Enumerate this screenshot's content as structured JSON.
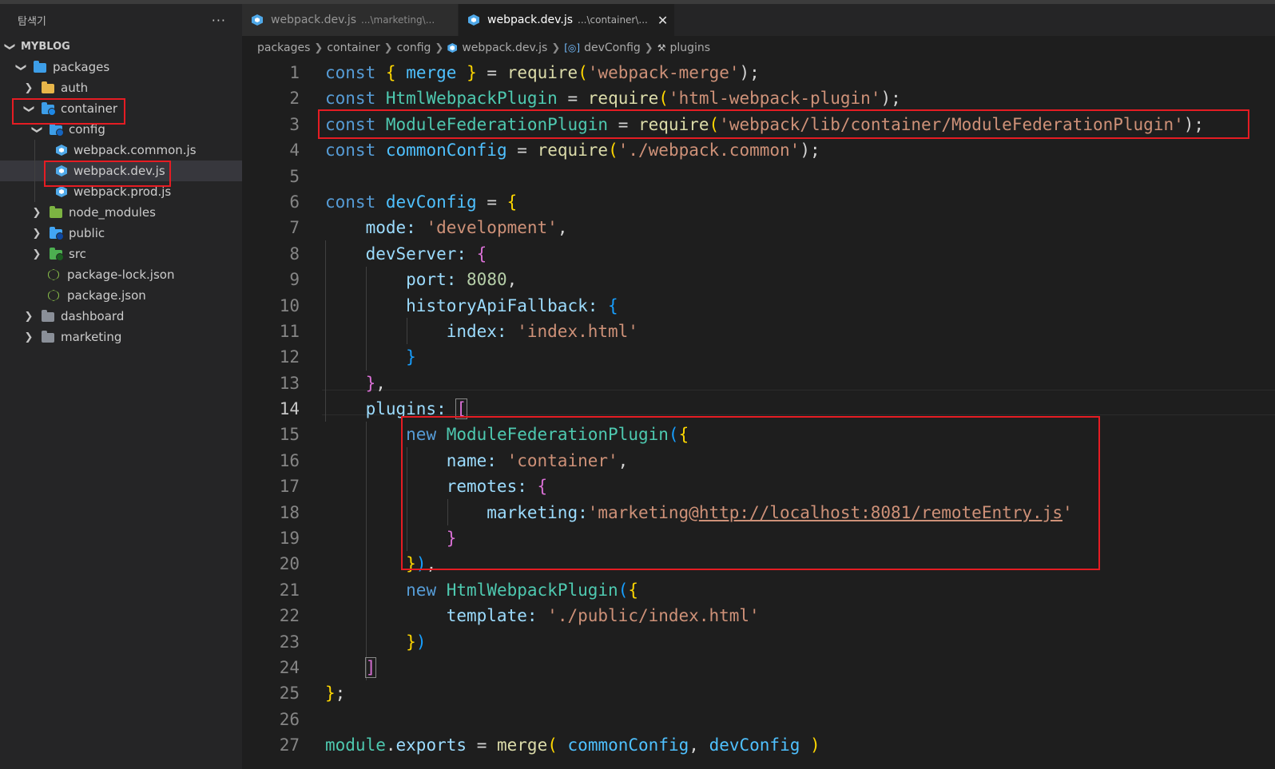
{
  "explorer": {
    "title": "탐색기",
    "more": "···",
    "root": "MYBLOG",
    "items": [
      {
        "label": "packages"
      },
      {
        "label": "auth"
      },
      {
        "label": "container"
      },
      {
        "label": "config"
      },
      {
        "label": "webpack.common.js"
      },
      {
        "label": "webpack.dev.js"
      },
      {
        "label": "webpack.prod.js"
      },
      {
        "label": "node_modules"
      },
      {
        "label": "public"
      },
      {
        "label": "src"
      },
      {
        "label": "package-lock.json"
      },
      {
        "label": "package.json"
      },
      {
        "label": "dashboard"
      },
      {
        "label": "marketing"
      }
    ]
  },
  "tabs": [
    {
      "name": "webpack.dev.js",
      "path": "...\\marketing\\..."
    },
    {
      "name": "webpack.dev.js",
      "path": "...\\container\\...",
      "close": "✕"
    }
  ],
  "breadcrumb": [
    "packages",
    "container",
    "config",
    "webpack.dev.js",
    "devConfig",
    "plugins"
  ],
  "editor": {
    "line_numbers": [
      "1",
      "2",
      "3",
      "4",
      "5",
      "6",
      "7",
      "8",
      "9",
      "10",
      "11",
      "12",
      "13",
      "14",
      "15",
      "16",
      "17",
      "18",
      "19",
      "20",
      "21",
      "22",
      "23",
      "24",
      "25",
      "26",
      "27"
    ],
    "current_line": "14",
    "code": {
      "l1": {
        "a": "const",
        "b": "{",
        "c": "merge",
        "d": "}",
        "e": "=",
        "f": "require",
        "g": "(",
        "h": "'webpack-merge'",
        "i": ");"
      },
      "l2": {
        "a": "const",
        "b": "HtmlWebpackPlugin",
        "c": "=",
        "d": "require",
        "e": "(",
        "f": "'html-webpack-plugin'",
        "g": ");"
      },
      "l3": {
        "a": "const",
        "b": "ModuleFederationPlugin",
        "c": "=",
        "d": "require",
        "e": "(",
        "f": "'webpack/lib/container/ModuleFederationPlugin'",
        "g": ");"
      },
      "l4": {
        "a": "const",
        "b": "commonConfig",
        "c": "=",
        "d": "require",
        "e": "(",
        "f": "'./webpack.common'",
        "g": ");"
      },
      "l6": {
        "a": "const",
        "b": "devConfig",
        "c": "=",
        "d": "{"
      },
      "l7": {
        "a": "mode:",
        "b": "'development'",
        "c": ","
      },
      "l8": {
        "a": "devServer:",
        "b": "{"
      },
      "l9": {
        "a": "port:",
        "b": "8080",
        "c": ","
      },
      "l10": {
        "a": "historyApiFallback:",
        "b": "{"
      },
      "l11": {
        "a": "index:",
        "b": "'index.html'"
      },
      "l12": {
        "a": "}"
      },
      "l13": {
        "a": "}",
        "b": ","
      },
      "l14": {
        "a": "plugins:",
        "b": "["
      },
      "l15": {
        "a": "new",
        "b": "ModuleFederationPlugin",
        "c": "(",
        "d": "{"
      },
      "l16": {
        "a": "name:",
        "b": "'container'",
        "c": ","
      },
      "l17": {
        "a": "remotes:",
        "b": "{"
      },
      "l18": {
        "a": "marketing:",
        "b": "'marketing@",
        "c": "http://localhost:8081/remoteEntry.js",
        "d": "'"
      },
      "l19": {
        "a": "}"
      },
      "l20": {
        "a": "}",
        "b": ")",
        "c": ","
      },
      "l21": {
        "a": "new",
        "b": "HtmlWebpackPlugin",
        "c": "(",
        "d": "{"
      },
      "l22": {
        "a": "template:",
        "b": "'./public/index.html'"
      },
      "l23": {
        "a": "}",
        "b": ")"
      },
      "l24": {
        "a": "]"
      },
      "l25": {
        "a": "}",
        "b": ";"
      },
      "l27": {
        "a": "module",
        "b": ".",
        "c": "exports",
        "d": "=",
        "e": "merge",
        "f": "(",
        "g": "commonConfig",
        "h": ",",
        "i": "devConfig",
        "j": ")"
      }
    }
  },
  "colors": {
    "highlight_box": "#e51c23",
    "background": "#1e1e1e",
    "sidebar": "#252526"
  }
}
